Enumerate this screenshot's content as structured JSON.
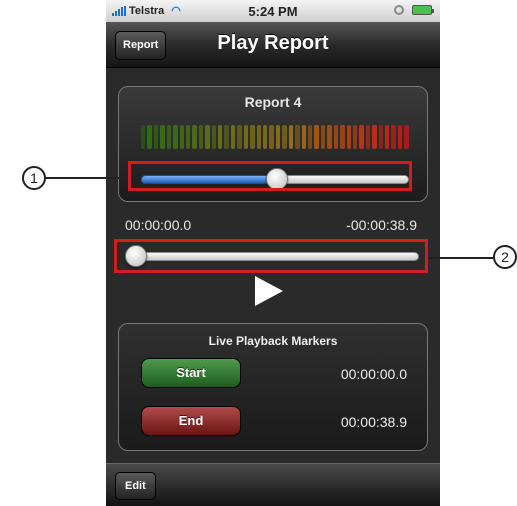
{
  "status_bar": {
    "carrier": "Telstra",
    "time": "5:24 PM"
  },
  "nav": {
    "back_label": "Report",
    "title": "Play Report"
  },
  "report": {
    "title": "Report 4",
    "volume_level": 0.51
  },
  "playback": {
    "elapsed": "00:00:00.0",
    "remaining": "-00:00:38.9",
    "position": 0.0
  },
  "markers": {
    "title": "Live Playback Markers",
    "start_label": "Start",
    "start_time": "00:00:00.0",
    "end_label": "End",
    "end_time": "00:00:38.9"
  },
  "toolbar": {
    "edit_label": "Edit"
  },
  "callouts": {
    "one": "1",
    "two": "2"
  },
  "colors": {
    "highlight": "#d41c1c",
    "slider_fill": "#2f73d6",
    "start_button": "#2f7a2f",
    "end_button": "#8e2020"
  }
}
